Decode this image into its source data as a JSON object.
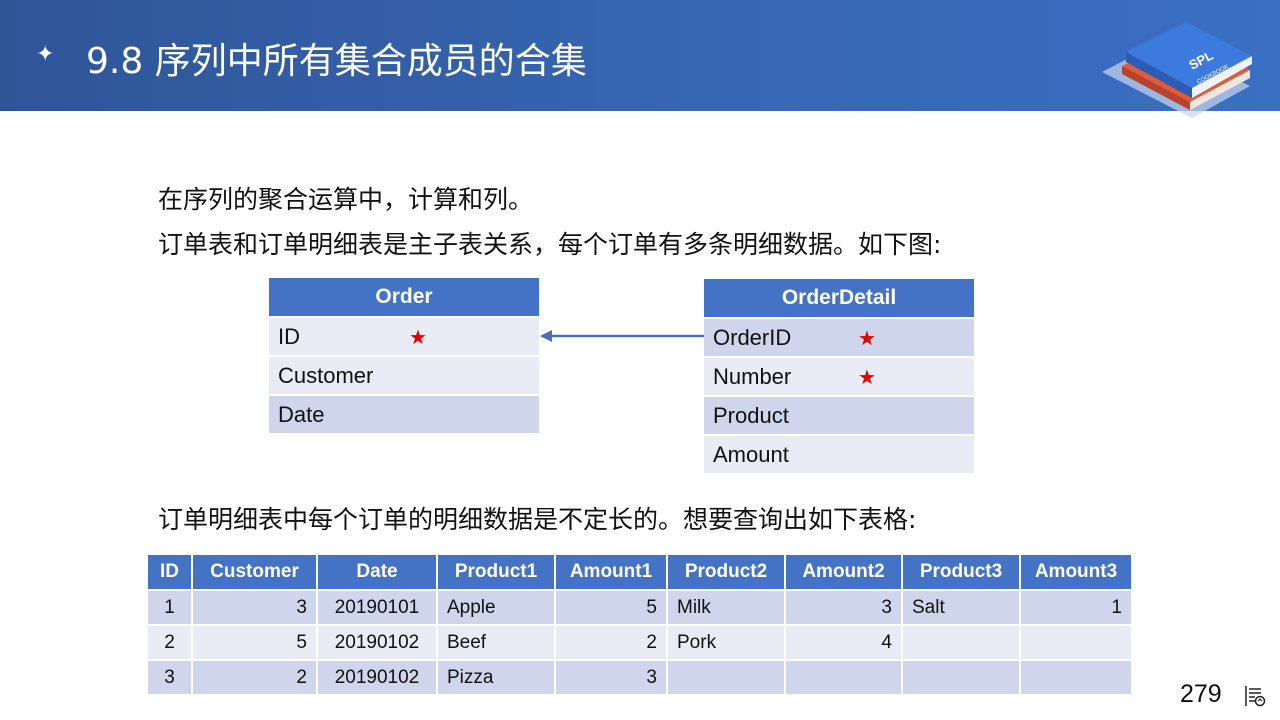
{
  "header": {
    "title": "9.8 序列中所有集合成员的合集",
    "logo_text": "SPL",
    "logo_subtext": "COOKBOOK"
  },
  "intro": {
    "line1": "在序列的聚合运算中，计算和列。",
    "line2": "订单表和订单明细表是主子表关系，每个订单有多条明细数据。如下图:",
    "line3": "订单明细表中每个订单的明细数据是不定长的。想要查询出如下表格:"
  },
  "order_table": {
    "title": "Order",
    "fields": [
      "ID",
      "Customer",
      "Date"
    ],
    "key_marker": "★"
  },
  "detail_table": {
    "title": "OrderDetail",
    "fields": [
      "OrderID",
      "Number",
      "Product",
      "Amount"
    ],
    "key_marker": "★"
  },
  "result_table": {
    "headers": [
      "ID",
      "Customer",
      "Date",
      "Product1",
      "Amount1",
      "Product2",
      "Amount2",
      "Product3",
      "Amount3"
    ],
    "rows": [
      [
        "1",
        "3",
        "20190101",
        "Apple",
        "5",
        "Milk",
        "3",
        "Salt",
        "1"
      ],
      [
        "2",
        "5",
        "20190102",
        "Beef",
        "2",
        "Pork",
        "4",
        "",
        ""
      ],
      [
        "3",
        "2",
        "20190102",
        "Pizza",
        "3",
        "",
        "",
        "",
        ""
      ]
    ]
  },
  "footer": {
    "page_number": "279",
    "icon": "page-view-icon"
  },
  "colors": {
    "header_blue": "#2f5597",
    "table_blue": "#4472c4",
    "row_dark": "#cfd5ea",
    "row_light": "#e9ebf5",
    "key_red": "#e00000"
  }
}
